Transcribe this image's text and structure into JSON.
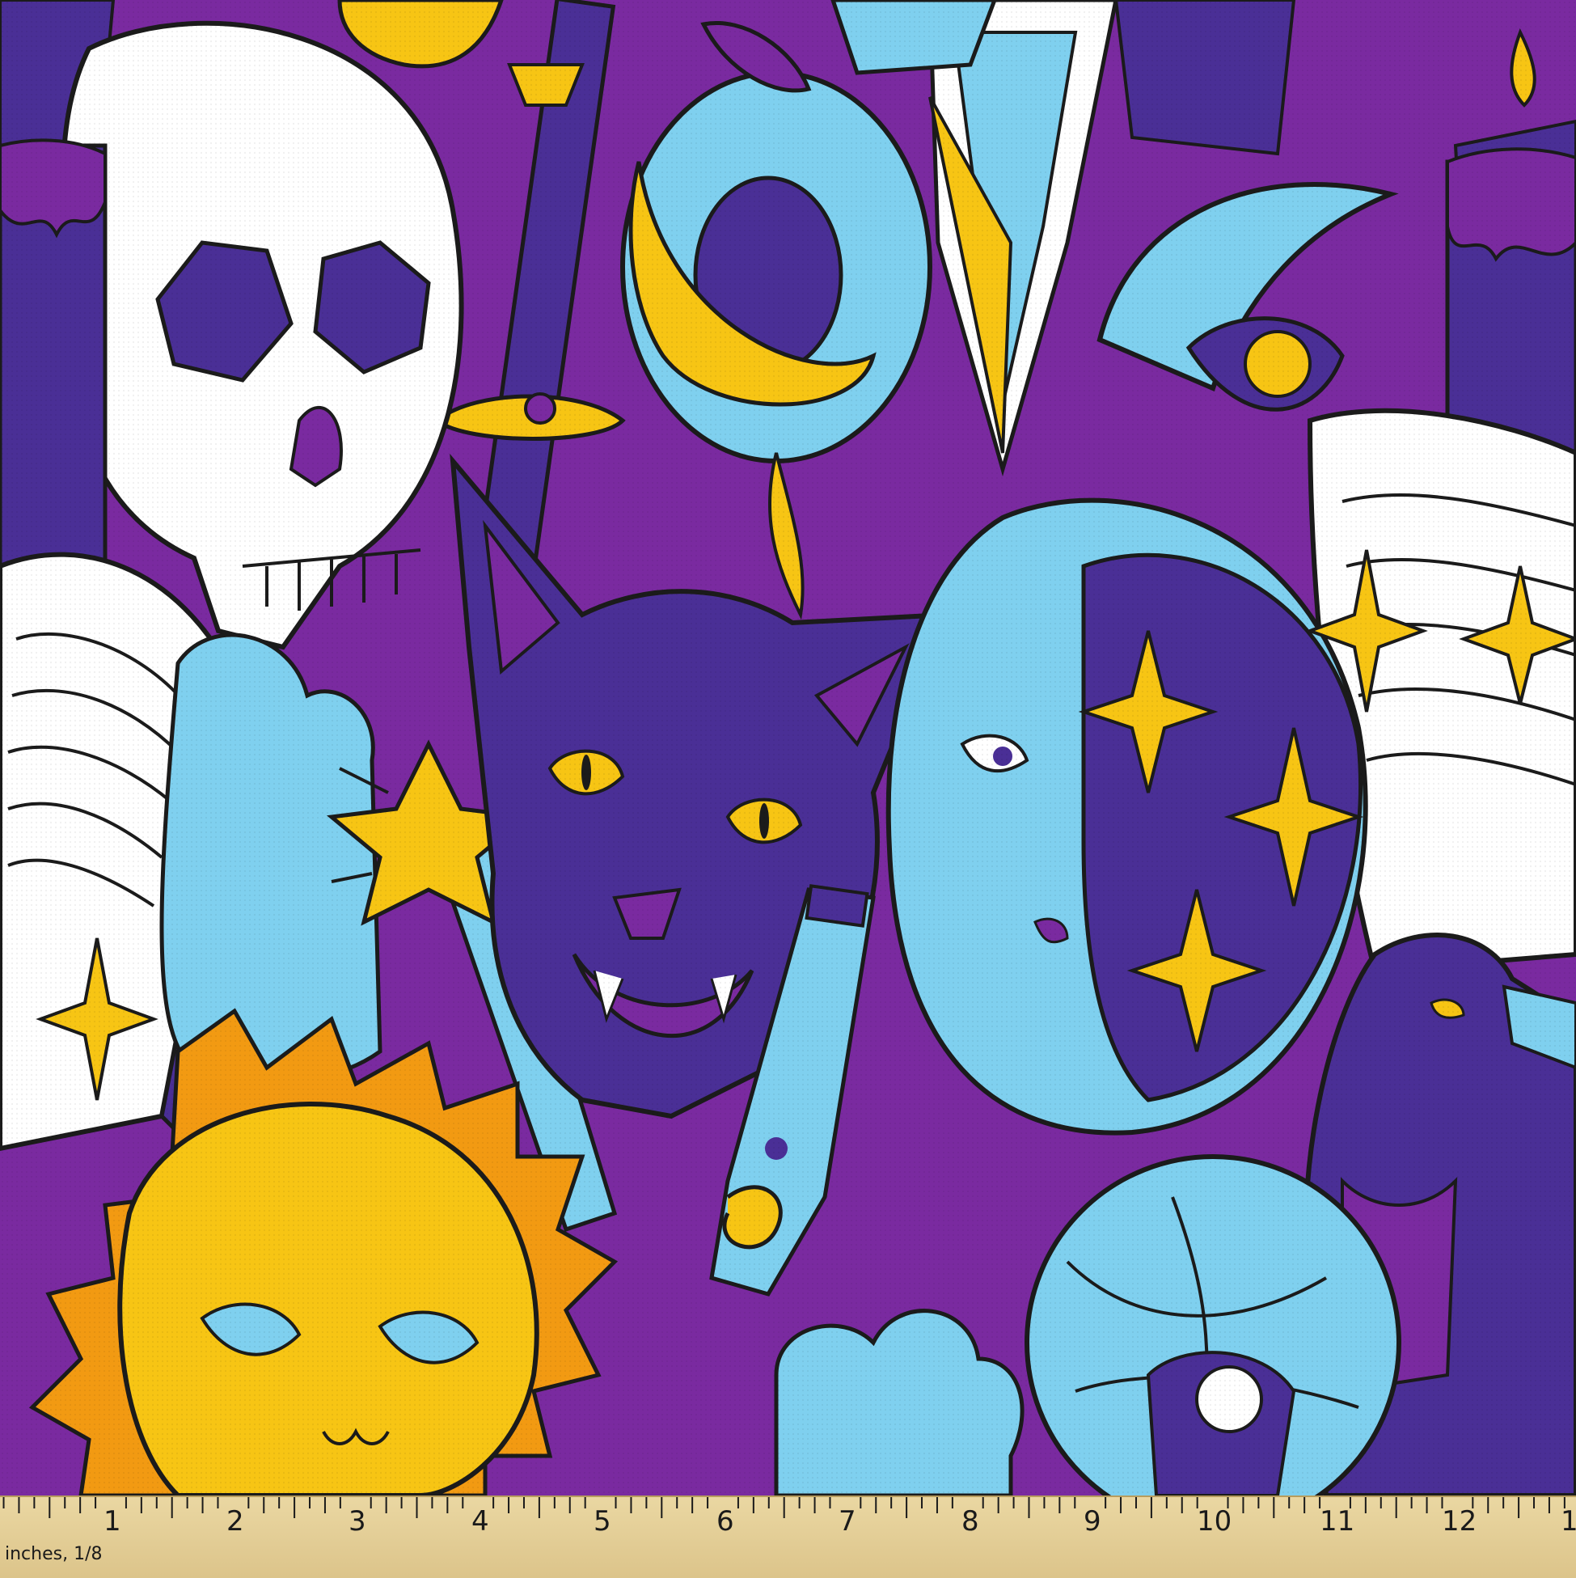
{
  "image": {
    "subject": "psychedelic mystic fabric print",
    "colors": {
      "purple": "#7a2aa0",
      "deep_purple": "#4a2f96",
      "light_blue": "#7fd0ef",
      "sky_blue": "#3fa5df",
      "yellow": "#f7c514",
      "orange": "#f29a12",
      "white": "#ffffff",
      "outline": "#1b1b1b"
    },
    "icons": [
      "skull-icon",
      "cat-icon",
      "moon-face-icon",
      "sun-face-icon",
      "crystal-ball-icon",
      "crow-icon",
      "book-icon",
      "star-icon",
      "candle-icon",
      "potion-icon"
    ]
  },
  "ruler": {
    "numbers": [
      "1",
      "2",
      "3",
      "4",
      "5",
      "6",
      "7",
      "8",
      "9",
      "10",
      "11",
      "12",
      "1"
    ],
    "unit_label": "inches, 1/8",
    "color": "#e3cd95"
  }
}
